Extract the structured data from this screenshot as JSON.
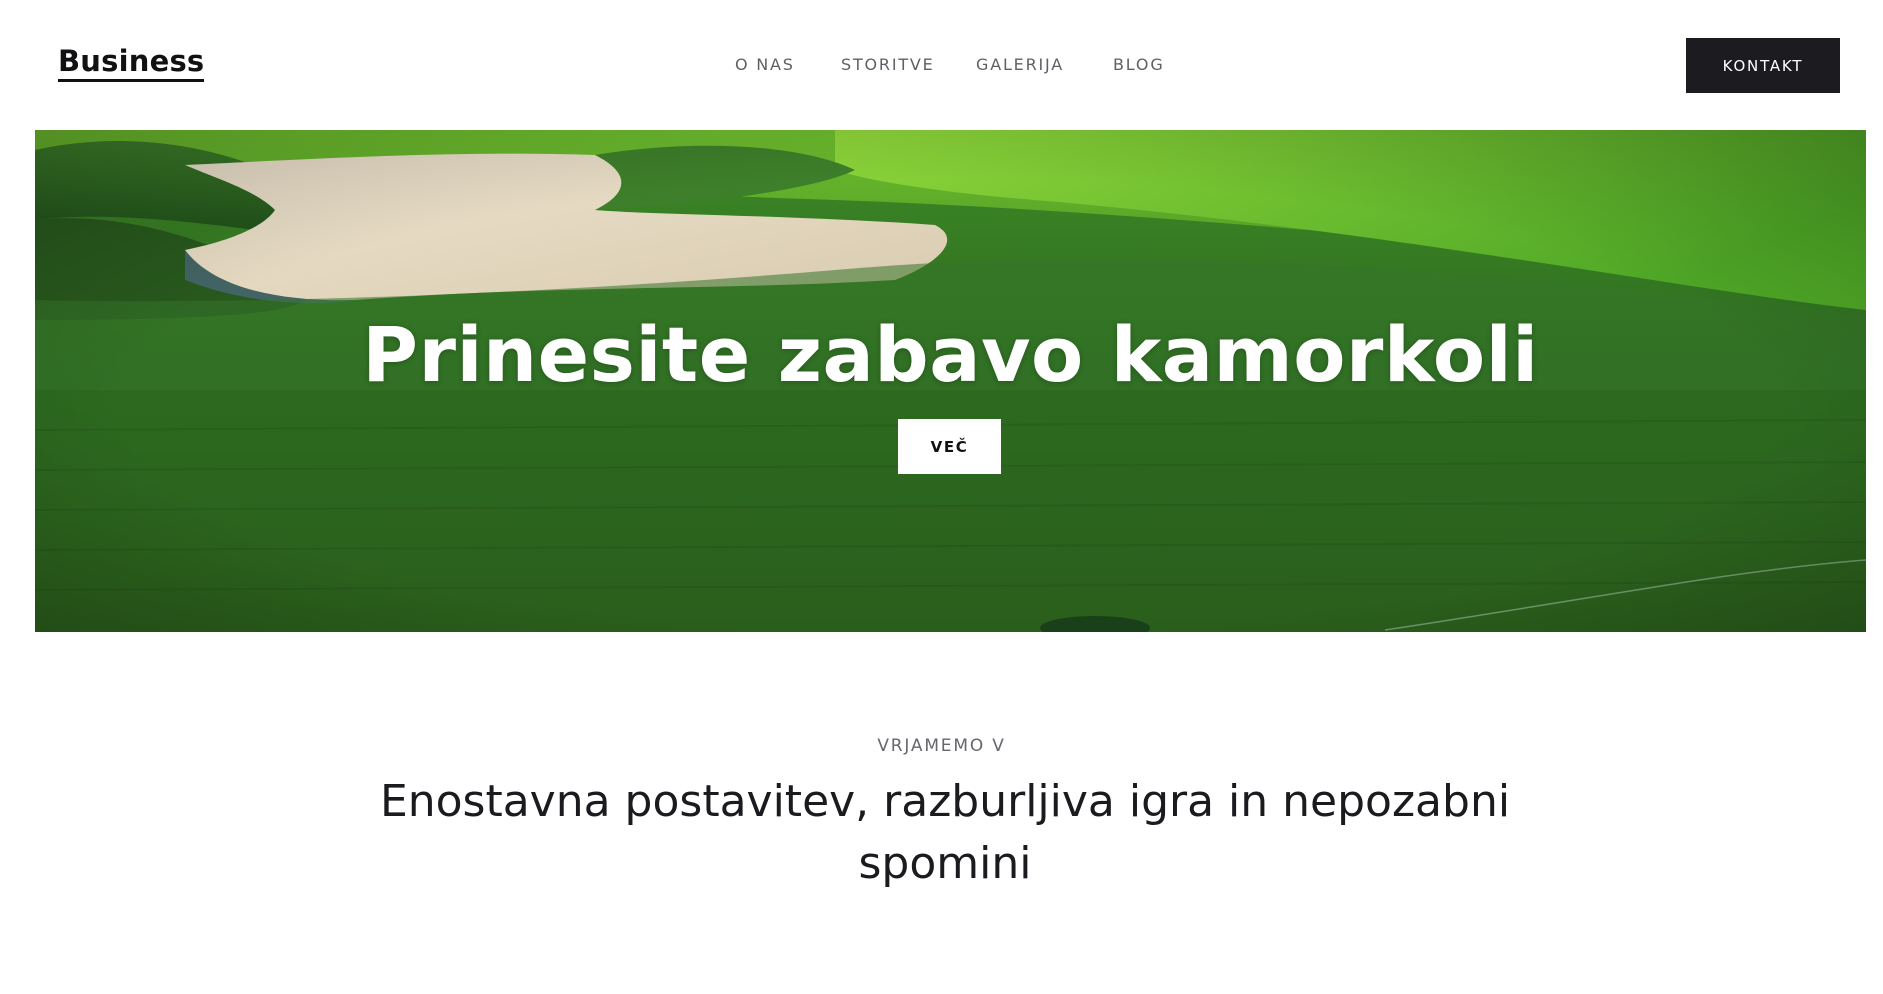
{
  "header": {
    "logo": "Business",
    "nav": [
      "O NAS",
      "STORITVE",
      "GALERIJA",
      "BLOG"
    ],
    "cta_label": "KONTAKT"
  },
  "hero": {
    "title": "Prinesite zabavo kamorkoli",
    "button_label": "VEČ",
    "image": "golf-course-photo"
  },
  "intro": {
    "eyebrow": "VRJAMEMO V",
    "heading": "Enostavna postavitev, razburljiva igra in nepozabni spomini"
  },
  "colors": {
    "dark": "#1c1c20",
    "grass": "#2f6e23",
    "light_grass": "#7fd02c",
    "sand": "#e4d8c0",
    "white": "#ffffff"
  }
}
